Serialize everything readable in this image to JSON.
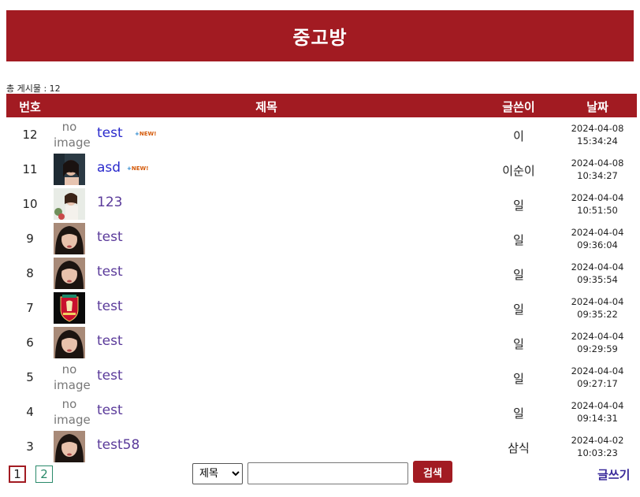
{
  "page": {
    "title": "중고방",
    "total_label": "총 게시물 : 12"
  },
  "table": {
    "headers": {
      "num": "번호",
      "title": "제목",
      "writer": "글쓴이",
      "date": "날짜"
    },
    "rows": [
      {
        "num": "12",
        "thumb": "none",
        "title": "test",
        "is_new": true,
        "writer": "이",
        "date": "2024-04-08",
        "time": "15:34:24"
      },
      {
        "num": "11",
        "thumb": "portrait-a",
        "title": "asd",
        "is_new": true,
        "writer": "이순이",
        "date": "2024-04-08",
        "time": "10:34:27"
      },
      {
        "num": "10",
        "thumb": "portrait-b",
        "title": "123",
        "is_new": false,
        "writer": "일",
        "date": "2024-04-04",
        "time": "10:51:50"
      },
      {
        "num": "9",
        "thumb": "portrait-c",
        "title": "test",
        "is_new": false,
        "writer": "일",
        "date": "2024-04-04",
        "time": "09:36:04"
      },
      {
        "num": "8",
        "thumb": "portrait-c",
        "title": "test",
        "is_new": false,
        "writer": "일",
        "date": "2024-04-04",
        "time": "09:35:54"
      },
      {
        "num": "7",
        "thumb": "crest",
        "title": "test",
        "is_new": false,
        "writer": "일",
        "date": "2024-04-04",
        "time": "09:35:22"
      },
      {
        "num": "6",
        "thumb": "portrait-c",
        "title": "test",
        "is_new": false,
        "writer": "일",
        "date": "2024-04-04",
        "time": "09:29:59"
      },
      {
        "num": "5",
        "thumb": "none",
        "title": "test",
        "is_new": false,
        "writer": "일",
        "date": "2024-04-04",
        "time": "09:27:17"
      },
      {
        "num": "4",
        "thumb": "none",
        "title": "test",
        "is_new": false,
        "writer": "일",
        "date": "2024-04-04",
        "time": "09:14:31"
      },
      {
        "num": "3",
        "thumb": "portrait-c",
        "title": "test58",
        "is_new": false,
        "writer": "삼식",
        "date": "2024-04-02",
        "time": "10:03:23"
      }
    ],
    "no_image_text_1": "no",
    "no_image_text_2": "image",
    "new_badge": "NEW!"
  },
  "pagination": {
    "pages": [
      "1",
      "2"
    ],
    "current": "1"
  },
  "search": {
    "field_selected": "제목",
    "value": "",
    "button_label": "검색"
  },
  "write_label": "글쓰기",
  "colors": {
    "brand": "#a21b22",
    "link": "#2a2acc",
    "visited": "#5a3a9a"
  }
}
